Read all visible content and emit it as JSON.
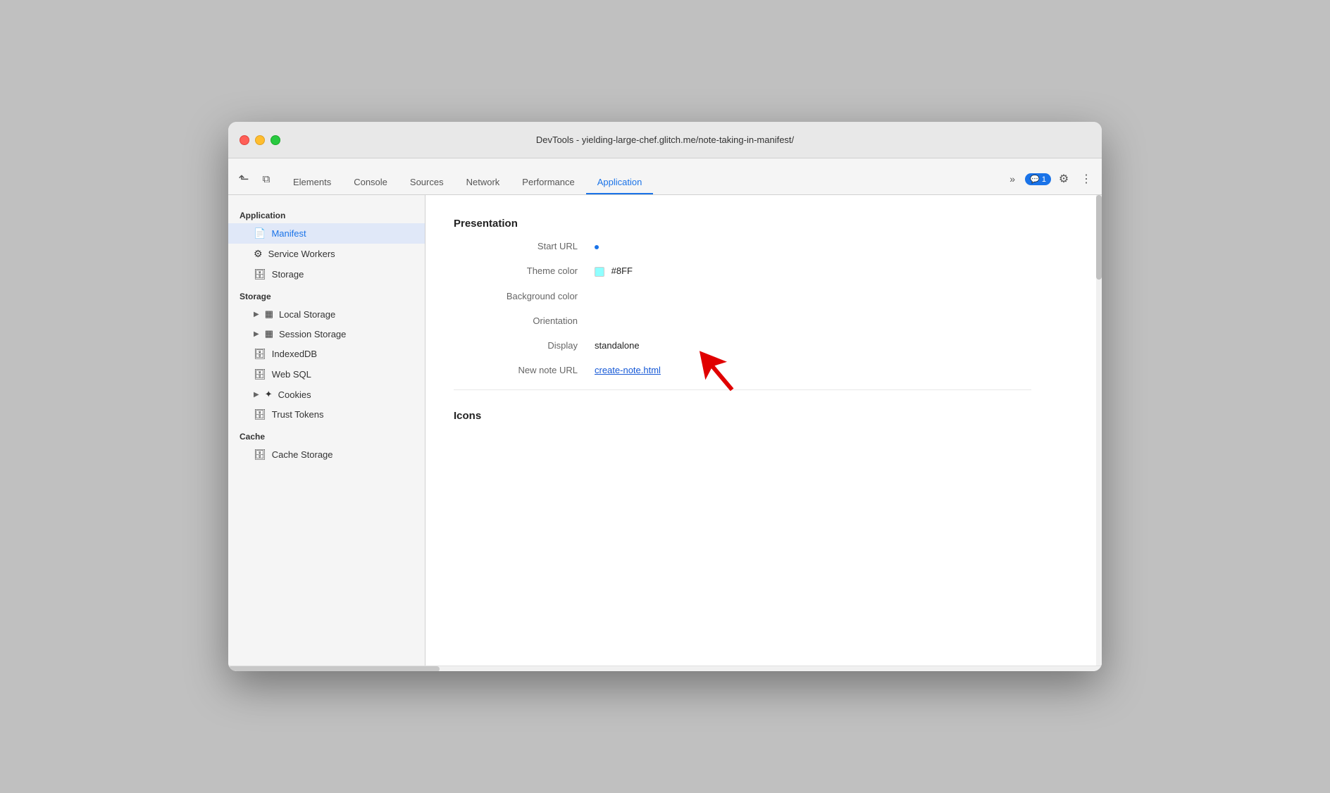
{
  "window": {
    "title": "DevTools - yielding-large-chef.glitch.me/note-taking-in-manifest/"
  },
  "toolbar": {
    "tabs": [
      {
        "id": "elements",
        "label": "Elements",
        "active": false
      },
      {
        "id": "console",
        "label": "Console",
        "active": false
      },
      {
        "id": "sources",
        "label": "Sources",
        "active": false
      },
      {
        "id": "network",
        "label": "Network",
        "active": false
      },
      {
        "id": "performance",
        "label": "Performance",
        "active": false
      },
      {
        "id": "application",
        "label": "Application",
        "active": true
      }
    ],
    "more_label": "»",
    "notifications": "1",
    "settings_icon": "⚙",
    "more_options_icon": "⋮"
  },
  "sidebar": {
    "application_section": "Application",
    "items_application": [
      {
        "id": "manifest",
        "label": "Manifest",
        "active": true,
        "icon": "📄"
      },
      {
        "id": "service-workers",
        "label": "Service Workers",
        "active": false,
        "icon": "⚙"
      },
      {
        "id": "storage",
        "label": "Storage",
        "active": false,
        "icon": "🗄"
      }
    ],
    "storage_section": "Storage",
    "items_storage": [
      {
        "id": "local-storage",
        "label": "Local Storage",
        "icon": "▦",
        "expandable": true
      },
      {
        "id": "session-storage",
        "label": "Session Storage",
        "icon": "▦",
        "expandable": true
      },
      {
        "id": "indexeddb",
        "label": "IndexedDB",
        "icon": "🗄",
        "expandable": false
      },
      {
        "id": "web-sql",
        "label": "Web SQL",
        "icon": "🗄",
        "expandable": false
      },
      {
        "id": "cookies",
        "label": "Cookies",
        "icon": "✦",
        "expandable": true
      },
      {
        "id": "trust-tokens",
        "label": "Trust Tokens",
        "icon": "🗄",
        "expandable": false
      }
    ],
    "cache_section": "Cache",
    "items_cache": [
      {
        "id": "cache-storage",
        "label": "Cache Storage",
        "icon": "🗄",
        "expandable": false
      }
    ]
  },
  "content": {
    "presentation_title": "Presentation",
    "rows": [
      {
        "label": "Start URL",
        "value": ".",
        "type": "dot"
      },
      {
        "label": "Theme color",
        "value": "#8FF",
        "type": "color"
      },
      {
        "label": "Background color",
        "value": "",
        "type": "text"
      },
      {
        "label": "Orientation",
        "value": "",
        "type": "text"
      },
      {
        "label": "Display",
        "value": "standalone",
        "type": "text"
      },
      {
        "label": "New note URL",
        "value": "create-note.html",
        "type": "link"
      }
    ],
    "icons_title": "Icons"
  }
}
